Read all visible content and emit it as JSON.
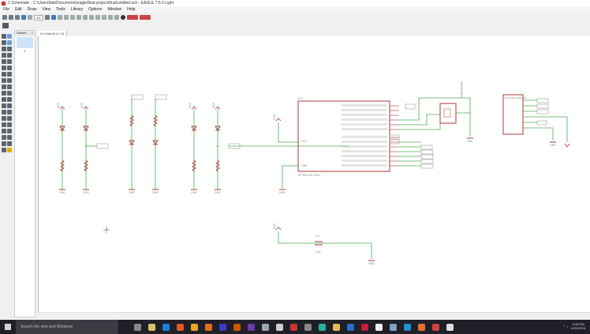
{
  "window": {
    "title": "2 Schematic - C:\\Users\\fab\\Documents\\eagle\\final project\\final\\untitled.sch - EAGLE 7.5.0 Light"
  },
  "menu": [
    "File",
    "Edit",
    "Draw",
    "View",
    "Tools",
    "Library",
    "Options",
    "Window",
    "Help"
  ],
  "toolbar": {
    "zoom_select": "1/1"
  },
  "sheets": {
    "title": "Sheets",
    "sheet_number": "1"
  },
  "tab": {
    "grid_label": "0.1 inch (6.4 1.3)"
  },
  "schematic": {
    "gnd": "GND",
    "vcc": "VCC",
    "ic_name": "IC1",
    "ic_value": "ATTINY44-SSU",
    "ic_pin_vcc": "VCC",
    "ic_pin_gnd": "GND",
    "header_name": "AVRISPSMD",
    "connector_name": "FTDI-SMD-HEADER",
    "cap_name": "C1",
    "cap_value": "1uF",
    "colors": {
      "wire": "#4caf50",
      "part": "#a83a3a",
      "label": "#888888",
      "canvas": "#ffffff"
    }
  },
  "taskbar": {
    "search_placeholder": "Search the web and Windows",
    "time": "5:08 PM",
    "date": "6/30/2016"
  },
  "palette_icons": [
    "info-icon",
    "eye-icon",
    "wrench-icon",
    "layer-icon",
    "move-icon",
    "copy-icon",
    "mirror-icon",
    "rotate-icon",
    "group-icon",
    "change-icon",
    "paste-icon",
    "delete-icon",
    "add-icon",
    "pinswap-icon",
    "replace-icon",
    "name-icon",
    "value-icon",
    "smash-icon",
    "split-icon",
    "miter-icon",
    "invoke-icon",
    "gate-icon",
    "wire-icon",
    "text-icon",
    "circle-icon",
    "arc-icon",
    "rect-icon",
    "polygon-icon",
    "bus-icon",
    "net-icon",
    "junction-icon",
    "label-icon",
    "attribute-icon",
    "dimension-icon",
    "erc-icon",
    "errors-icon",
    "frame-icon",
    "warning-icon"
  ]
}
